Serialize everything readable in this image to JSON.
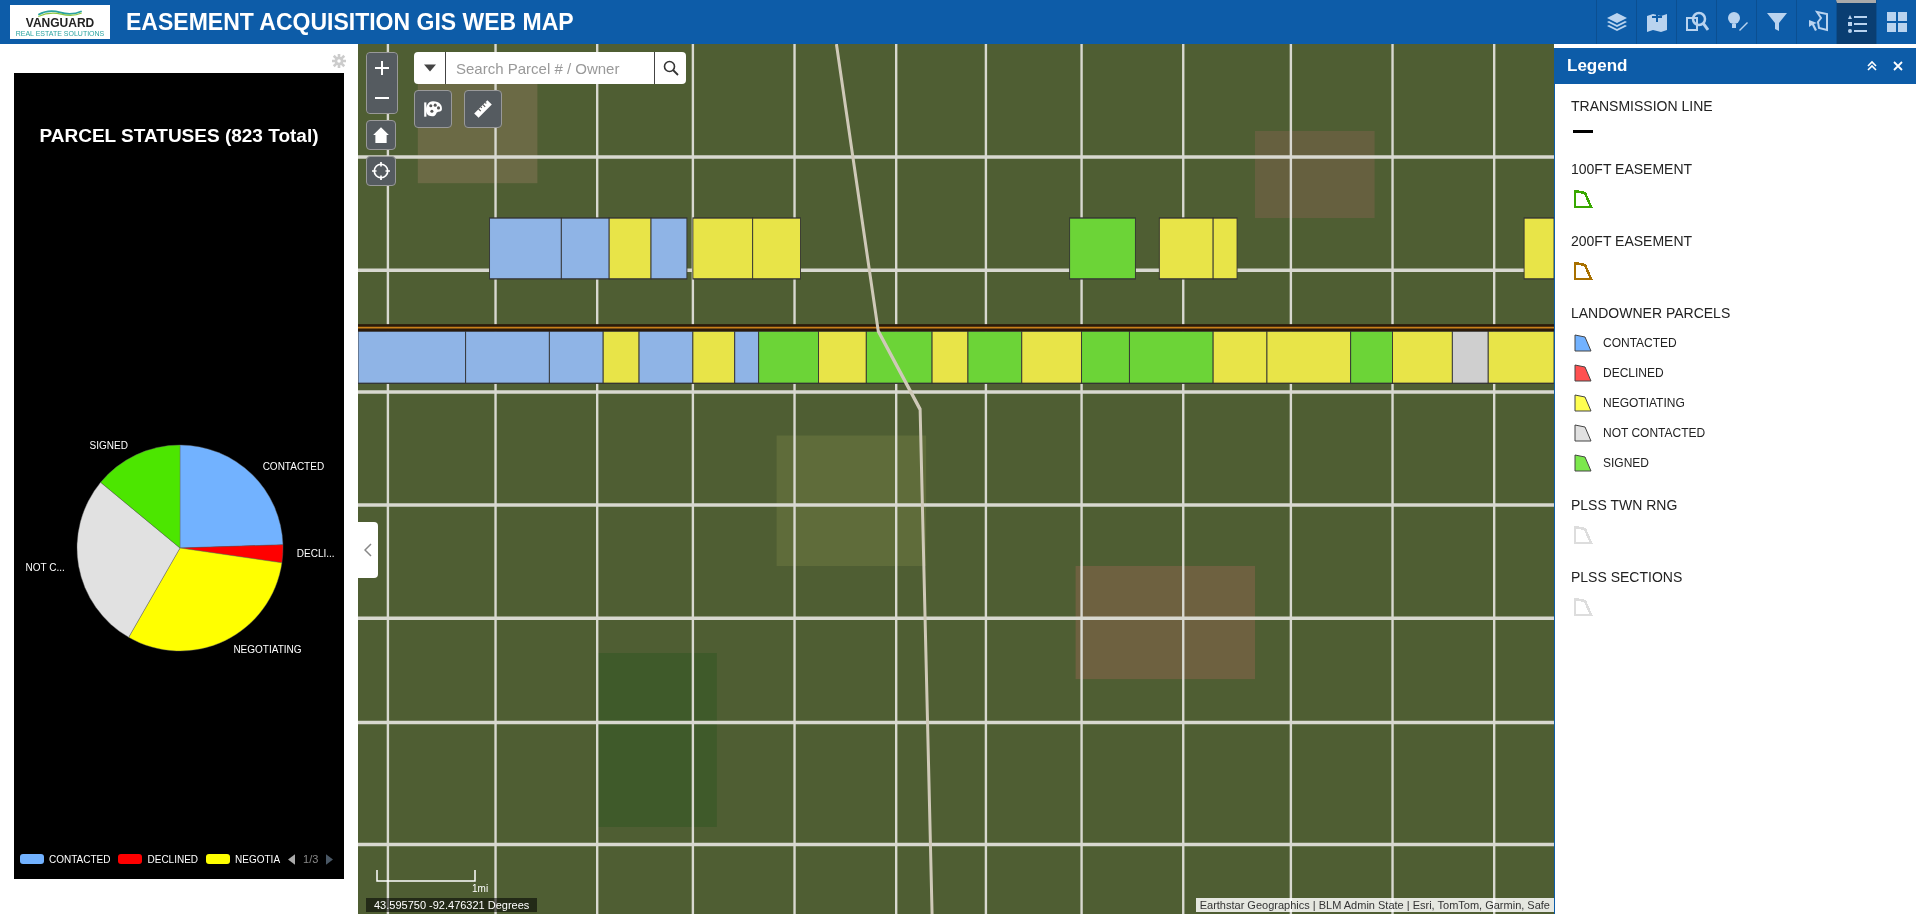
{
  "header": {
    "logo_text": "VANGUARD",
    "logo_subtext": "REAL ESTATE SOLUTIONS",
    "title": "EASEMENT ACQUISITION GIS WEB MAP",
    "tools": [
      {
        "kind": "layers",
        "selected": false
      },
      {
        "kind": "add-data",
        "selected": false
      },
      {
        "kind": "query",
        "selected": false
      },
      {
        "kind": "edit",
        "selected": false
      },
      {
        "kind": "filter",
        "selected": false
      },
      {
        "kind": "select",
        "selected": false
      },
      {
        "kind": "legend",
        "selected": true
      },
      {
        "kind": "grid",
        "selected": false
      }
    ]
  },
  "chart_panel": {
    "title": "PARCEL STATUSES (823 Total)",
    "slices": [
      {
        "label": "CONTACTED",
        "color": "#72b2ff"
      },
      {
        "label": "DECLI...",
        "color": "#ff0000"
      },
      {
        "label": "NEGOTIATING",
        "color": "#ffff00"
      },
      {
        "label": "NOT C...",
        "color": "#e1e1e1"
      },
      {
        "label": "SIGNED",
        "color": "#4ce600"
      }
    ],
    "legend": [
      {
        "label": "CONTACTED",
        "color": "#72b2ff"
      },
      {
        "label": "DECLINED",
        "color": "#ff0000"
      },
      {
        "label": "NEGOTIA",
        "color": "#ffff00"
      }
    ],
    "page": "1/3"
  },
  "map": {
    "search": {
      "placeholder": "Search Parcel # / Owner"
    },
    "coordinates": "43.595750 -92.476321 Degrees",
    "scale": "1mi",
    "attribution": "Earthstar Geographics | BLM Admin State | Esri, TomTom, Garmin, Safe"
  },
  "legend_panel": {
    "title": "Legend",
    "sections": [
      {
        "title": "TRANSMISSION LINE",
        "items": [
          {
            "kind": "line",
            "color": "#000000"
          }
        ]
      },
      {
        "title": "100FT EASEMENT",
        "items": [
          {
            "kind": "outline",
            "color": "#38a800"
          }
        ]
      },
      {
        "title": "200FT EASEMENT",
        "items": [
          {
            "kind": "outline",
            "color": "#a87000"
          }
        ]
      },
      {
        "title": "LANDOWNER PARCELS",
        "items": [
          {
            "kind": "fill",
            "color": "#72b2ff",
            "label": "CONTACTED"
          },
          {
            "kind": "fill",
            "color": "#ff5050",
            "label": "DECLINED"
          },
          {
            "kind": "fill",
            "color": "#ffff50",
            "label": "NEGOTIATING"
          },
          {
            "kind": "fill",
            "color": "#e1e1e1",
            "label": "NOT CONTACTED"
          },
          {
            "kind": "fill",
            "color": "#7ce84c",
            "label": "SIGNED"
          }
        ]
      },
      {
        "title": "PLSS TWN RNG",
        "items": [
          {
            "kind": "outline",
            "color": "#dddddd"
          }
        ]
      },
      {
        "title": "PLSS SECTIONS",
        "items": [
          {
            "kind": "outline",
            "color": "#dddddd"
          }
        ]
      }
    ]
  }
}
